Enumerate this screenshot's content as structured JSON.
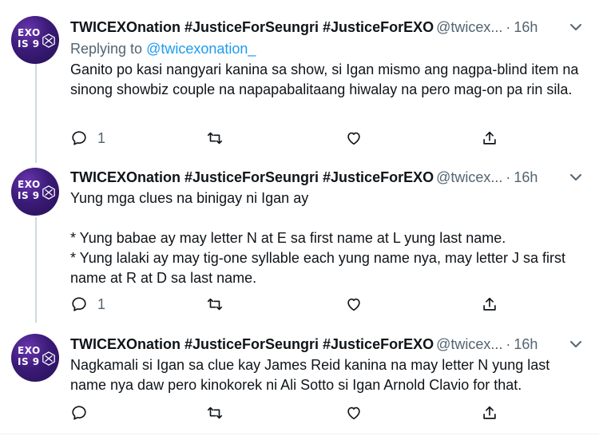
{
  "tweets": [
    {
      "avatar_text": [
        "EXO",
        "IS 9"
      ],
      "name": "TWICEXOnation #JusticeForSeungri #JusticeForEXO",
      "handle": "@twicex...",
      "separator": "·",
      "time": "16h",
      "reply_prefix": "Replying to",
      "reply_mention": "@twicexonation_",
      "body": [
        "Ganito po kasi nangyari kanina sa show, si Igan mismo ang nagpa-blind item na sinong showbiz couple na napapabalitaang hiwalay na pero mag-on pa rin sila."
      ],
      "reply_count": "1"
    },
    {
      "avatar_text": [
        "EXO",
        "IS 9"
      ],
      "name": "TWICEXOnation #JusticeForSeungri #JusticeForEXO",
      "handle": "@twicex...",
      "separator": "·",
      "time": "16h",
      "body": [
        "Yung mga clues na binigay ni Igan ay",
        "* Yung babae ay may letter N at E sa first name at L yung last name.",
        "* Yung lalaki ay may tig-one syllable each yung name nya, may letter J sa first name at R at D sa last name."
      ],
      "reply_count": "1"
    },
    {
      "avatar_text": [
        "EXO",
        "IS 9"
      ],
      "name": "TWICEXOnation #JusticeForSeungri #JusticeForEXO",
      "handle": "@twicex...",
      "separator": "·",
      "time": "16h",
      "body": [
        "Nagkamali si Igan sa clue kay James Reid kanina na may letter N yung last name nya daw pero kinokorek ni Ali Sotto si Igan Arnold Clavio for that."
      ],
      "reply_count": ""
    }
  ],
  "icons": {
    "reply": "reply-icon",
    "retweet": "retweet-icon",
    "like": "heart-icon",
    "share": "share-icon",
    "more": "chevron-down-icon"
  },
  "colors": {
    "text": "#0f1419",
    "secondary": "#536471",
    "link": "#1d9bf0",
    "thread_line": "#cfd9de",
    "avatar_bg": "#3b1b78"
  }
}
